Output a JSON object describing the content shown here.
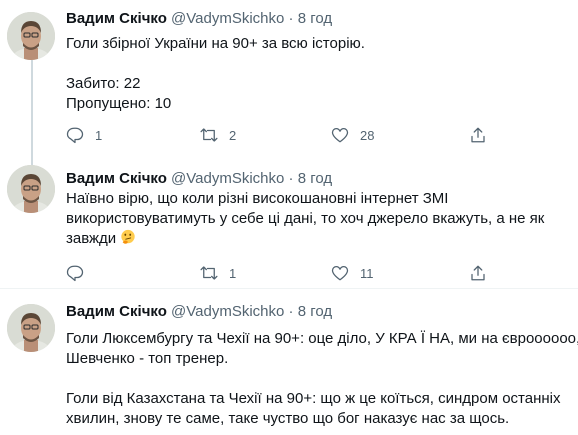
{
  "tweets": [
    {
      "author": "Вадим Скічко",
      "handle": "@VadymSkichko",
      "separator": "·",
      "time": "8 год",
      "lines": [
        "Голи збірної України на 90+ за всю історію.",
        "",
        "Забито: 22",
        "Пропущено: 10"
      ],
      "emoji": null,
      "replies": "1",
      "retweets": "2",
      "likes": "28"
    },
    {
      "author": "Вадим Скічко",
      "handle": "@VadymSkichko",
      "separator": "·",
      "time": "8 год",
      "lines": [
        "Наївно вірю, що коли різні високошановні інтернет ЗМІ",
        "використовуватимуть у себе ці дані, то хоч джерело вкажуть, а не як",
        "завжди"
      ],
      "emoji": "thinking-face-emoji",
      "replies": "",
      "retweets": "1",
      "likes": "11"
    },
    {
      "author": "Вадим Скічко",
      "handle": "@VadymSkichko",
      "separator": "·",
      "time": "8 год",
      "lines": [
        "Голи Люксембургу та Чехії на 90+: оце діло, У КРА Ї НА, ми на євроооооо,",
        "Шевченко - топ тренер.",
        "",
        "Голи від Казахстана та Чехії на 90+: що ж це коїться, синдром останніх",
        "хвилин, знову те саме, таке чуство що бог наказує нас за щось."
      ],
      "emoji": null,
      "replies": "",
      "retweets": "",
      "likes": ""
    }
  ],
  "icons": {
    "reply": "reply-icon",
    "retweet": "retweet-icon",
    "like": "heart-icon",
    "share": "share-icon"
  },
  "colors": {
    "text": "#0f1419",
    "secondary": "#536471",
    "divider": "#eff3f4",
    "thread_line": "#cfd9de"
  }
}
